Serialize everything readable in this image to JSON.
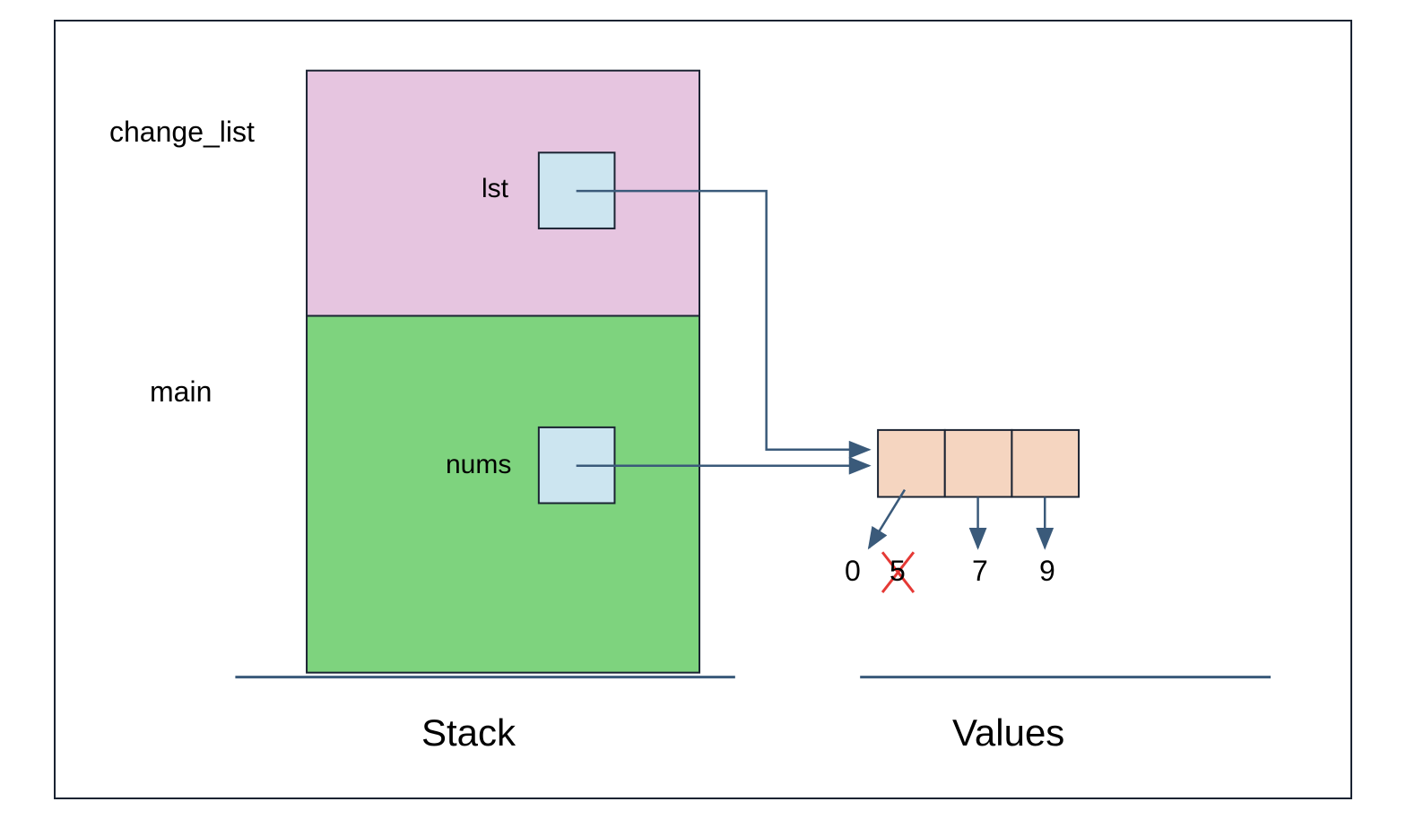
{
  "stack": {
    "label": "Stack",
    "frames": [
      {
        "name": "change_list",
        "variable": "lst"
      },
      {
        "name": "main",
        "variable": "nums"
      }
    ]
  },
  "values": {
    "label": "Values",
    "list_items": [
      {
        "value": "0",
        "new": true
      },
      {
        "value": "5",
        "crossed": true
      },
      {
        "value": "7"
      },
      {
        "value": "9"
      }
    ]
  },
  "colors": {
    "frame_top": "#e6c5e0",
    "frame_bottom": "#7ed37e",
    "var_box": "#cce5f0",
    "value_cell": "#f5d5c0",
    "border": "#1a2332",
    "arrow": "#3a5a7a",
    "cross": "#e53935"
  }
}
